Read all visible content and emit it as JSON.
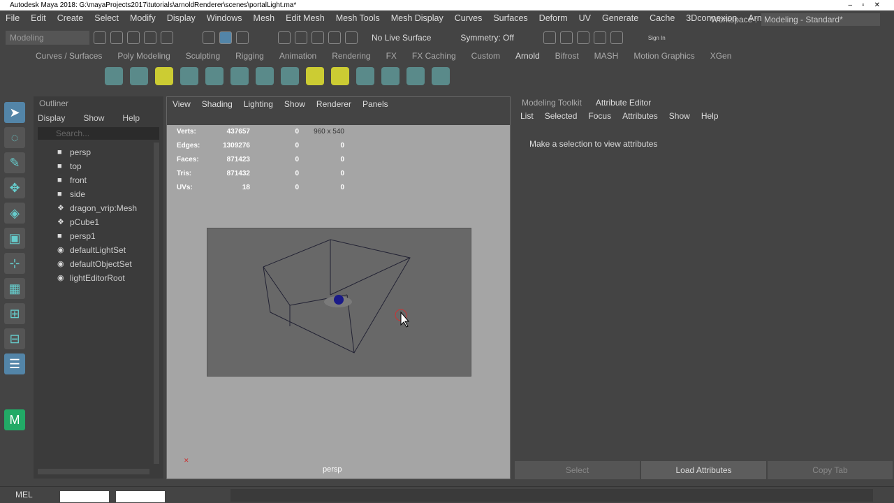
{
  "title": "Autodesk Maya 2018: G:\\mayaProjects2017\\tutorials\\arnoldRenderer\\scenes\\portalLight.ma*",
  "menu": [
    "File",
    "Edit",
    "Create",
    "Select",
    "Modify",
    "Display",
    "Windows",
    "Mesh",
    "Edit Mesh",
    "Mesh Tools",
    "Mesh Display",
    "Curves",
    "Surfaces",
    "Deform",
    "UV",
    "Generate",
    "Cache",
    "3Dconnexion",
    "Arnold"
  ],
  "workspace": {
    "label": "Workspace :",
    "value": "Modeling - Standard*"
  },
  "status": {
    "mode": "Modeling",
    "live_surface": "No Live Surface",
    "symmetry": "Symmetry: Off",
    "sign_in": "Sign In"
  },
  "shelf_tabs": [
    "Curves / Surfaces",
    "Poly Modeling",
    "Sculpting",
    "Rigging",
    "Animation",
    "Rendering",
    "FX",
    "FX Caching",
    "Custom",
    "Arnold",
    "Bifrost",
    "MASH",
    "Motion Graphics",
    "XGen"
  ],
  "shelf_active": "Arnold",
  "outliner": {
    "title": "Outliner",
    "menu": [
      "Display",
      "Show",
      "Help"
    ],
    "search_placeholder": "Search...",
    "items": [
      {
        "label": "persp",
        "icon": "camera"
      },
      {
        "label": "top",
        "icon": "camera"
      },
      {
        "label": "front",
        "icon": "camera"
      },
      {
        "label": "side",
        "icon": "camera"
      },
      {
        "label": "dragon_vrip:Mesh",
        "icon": "mesh"
      },
      {
        "label": "pCube1",
        "icon": "mesh"
      },
      {
        "label": "persp1",
        "icon": "camera"
      },
      {
        "label": "defaultLightSet",
        "icon": "set"
      },
      {
        "label": "defaultObjectSet",
        "icon": "set"
      },
      {
        "label": "lightEditorRoot",
        "icon": "set"
      }
    ]
  },
  "mouse_overlay": {
    "count": "x 2"
  },
  "viewport": {
    "menu": [
      "View",
      "Shading",
      "Lighting",
      "Show",
      "Renderer",
      "Panels"
    ],
    "resolution": "960 x 540",
    "camera": "persp",
    "hud": [
      [
        "Verts:",
        "437657",
        "0",
        "0"
      ],
      [
        "Edges:",
        "1309276",
        "0",
        "0"
      ],
      [
        "Faces:",
        "871423",
        "0",
        "0"
      ],
      [
        "Tris:",
        "871432",
        "0",
        "0"
      ],
      [
        "UVs:",
        "18",
        "0",
        "0"
      ]
    ]
  },
  "right_panel": {
    "tabs": [
      "Modeling Toolkit",
      "Attribute Editor"
    ],
    "active_tab": "Attribute Editor",
    "menu": [
      "List",
      "Selected",
      "Focus",
      "Attributes",
      "Show",
      "Help"
    ],
    "message": "Make a selection to view attributes",
    "buttons": [
      "Select",
      "Load Attributes",
      "Copy Tab"
    ]
  },
  "cmdline": {
    "label": "MEL"
  }
}
